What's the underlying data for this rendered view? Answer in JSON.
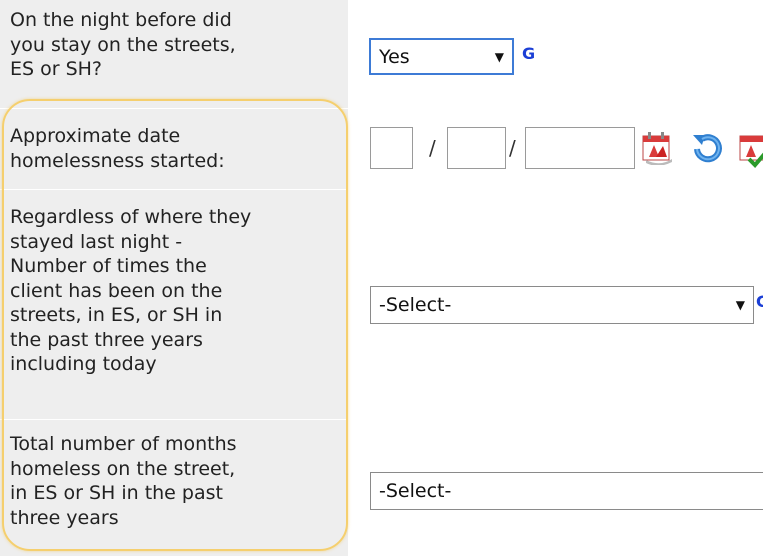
{
  "rows": [
    {
      "label_lines": [
        "On the night before did",
        "you stay on the streets,",
        "ES or SH?"
      ]
    },
    {
      "label_lines": [
        "Approximate date",
        "homelessness started:"
      ]
    },
    {
      "label_lines": [
        "Regardless of where they",
        "stayed last night -",
        "Number of times the",
        "client has been on the",
        "streets, in ES, or SH in",
        "the past three years",
        "including today"
      ]
    },
    {
      "label_lines": [
        "Total number of months",
        "homeless on the street,",
        "in ES or SH in the past",
        "three years"
      ]
    }
  ],
  "controls": {
    "stayed_streets_value": "Yes",
    "g_link": "G",
    "date_separator": "/",
    "times_select_value": "-Select-",
    "months_select_value": "-Select-"
  },
  "icons": {
    "calendar": "calendar-icon",
    "refresh": "refresh-icon",
    "calendar_check": "calendar-check-icon"
  },
  "colors": {
    "label_background": "#eeeeee",
    "highlight_border": "#f5cf6e",
    "link_blue": "#1b3fd6",
    "select_focus_border": "#3d7bd6"
  }
}
